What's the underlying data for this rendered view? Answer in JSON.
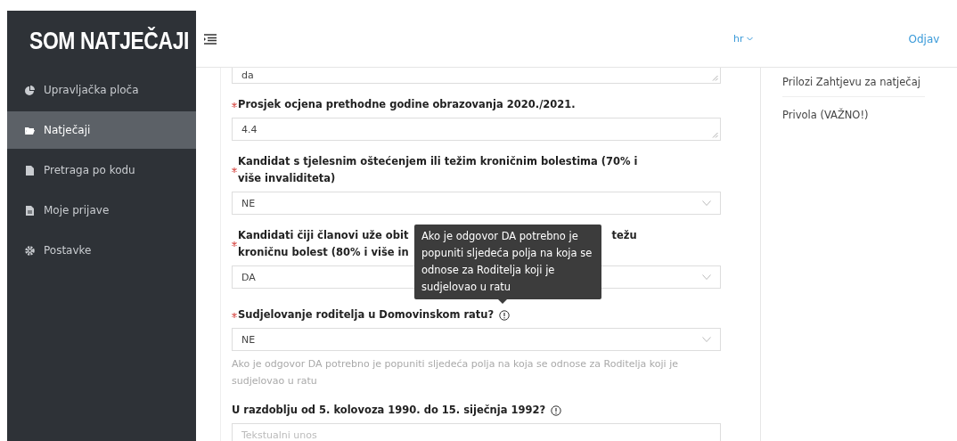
{
  "sidebar": {
    "logo": "SOM NATJEČAJI",
    "items": [
      {
        "label": "Upravljačka ploča",
        "selected": false
      },
      {
        "label": "Natječaji",
        "selected": true
      },
      {
        "label": "Pretraga po kodu",
        "selected": false
      },
      {
        "label": "Moje prijave",
        "selected": false
      },
      {
        "label": "Postavke",
        "selected": false
      }
    ]
  },
  "header": {
    "language": "hr",
    "logout": "Odjav"
  },
  "form": {
    "fields": [
      {
        "kind": "textarea",
        "value": "da"
      },
      {
        "kind": "textarea",
        "required": true,
        "label": "Prosjek ocjena prethodne godine obrazovanja 2020./2021.",
        "value": "4.4"
      },
      {
        "kind": "select",
        "required": true,
        "label": "Kandidat s tjelesnim oštećenjem ili težim kroničnim bolestima (70% i više invaliditeta)",
        "value": "NE"
      },
      {
        "kind": "select",
        "required": true,
        "label_lines": [
          [
            "Kandidati čiji članovi uže obit",
            "težu"
          ],
          [
            "kroničnu bolest (80% i više in"
          ]
        ],
        "value": "DA"
      },
      {
        "kind": "select",
        "required": true,
        "label": "Sudjelovanje roditelja u Domovinskom ratu?",
        "info": true,
        "value": "NE",
        "help": "Ako je odgovor DA potrebno je popuniti sljedeća polja na koja se odnose za Roditelja koji je sudjelovao u ratu"
      },
      {
        "kind": "input",
        "label": "U razdoblju od 5. kolovoza 1990. do 15. siječnja 1992?",
        "info": true,
        "placeholder": "Tekstualni unos"
      }
    ],
    "tooltip": {
      "text": "Ako je odgovor DA potrebno je popuniti sljedeća polja na koja se odnose za Roditelja koji je sudjelovao u ratu"
    }
  },
  "side_panel": {
    "items": [
      "Prilozi Zahtjevu za natječaj",
      "Privola (VAŽNO!)"
    ]
  }
}
